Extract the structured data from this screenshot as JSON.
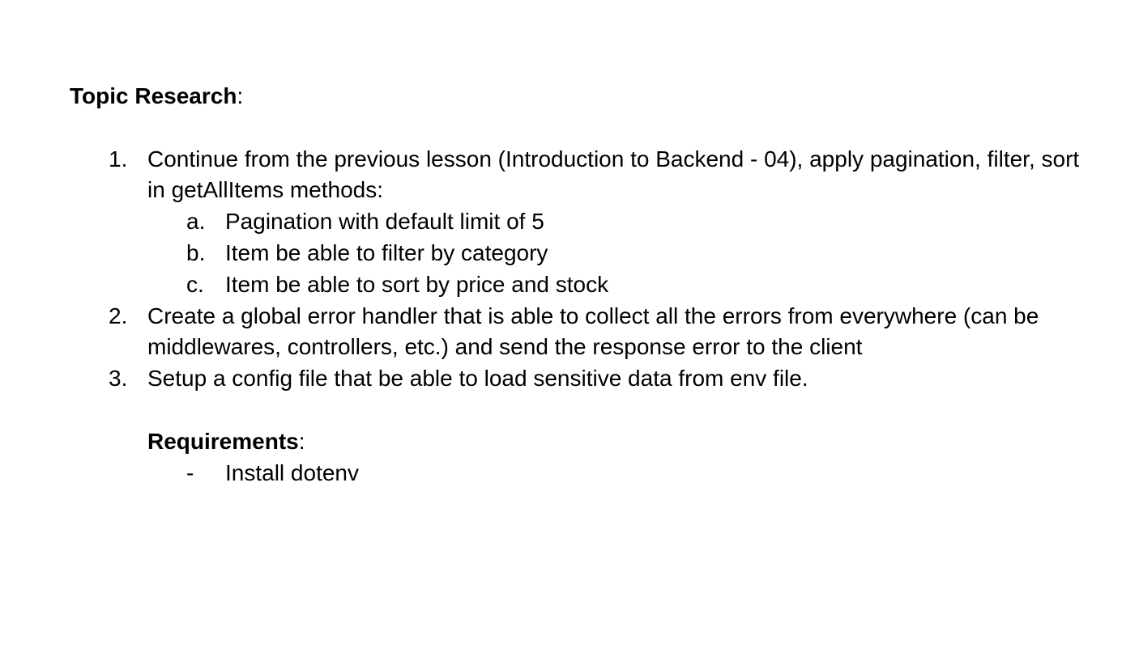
{
  "topic": {
    "heading": "Topic Research",
    "colon": ":"
  },
  "items": [
    {
      "marker": "1.",
      "text": "Continue from the previous lesson (Introduction to Backend - 04), apply pagination, filter, sort in getAllItems methods:",
      "subitems": [
        {
          "marker": "a.",
          "text": "Pagination with default limit of 5"
        },
        {
          "marker": "b.",
          "text": "Item be able to filter by category"
        },
        {
          "marker": "c.",
          "text": "Item be able to sort by price and stock"
        }
      ]
    },
    {
      "marker": "2.",
      "text": "Create a global error handler that is able to collect all the errors from everywhere (can be middlewares, controllers, etc.) and send the response error to the client"
    },
    {
      "marker": "3.",
      "text": "Setup a config file that be able to load sensitive data from env file."
    }
  ],
  "requirements": {
    "heading": "Requirements",
    "colon": ":",
    "items": [
      {
        "marker": "-",
        "text": "Install dotenv"
      }
    ]
  }
}
